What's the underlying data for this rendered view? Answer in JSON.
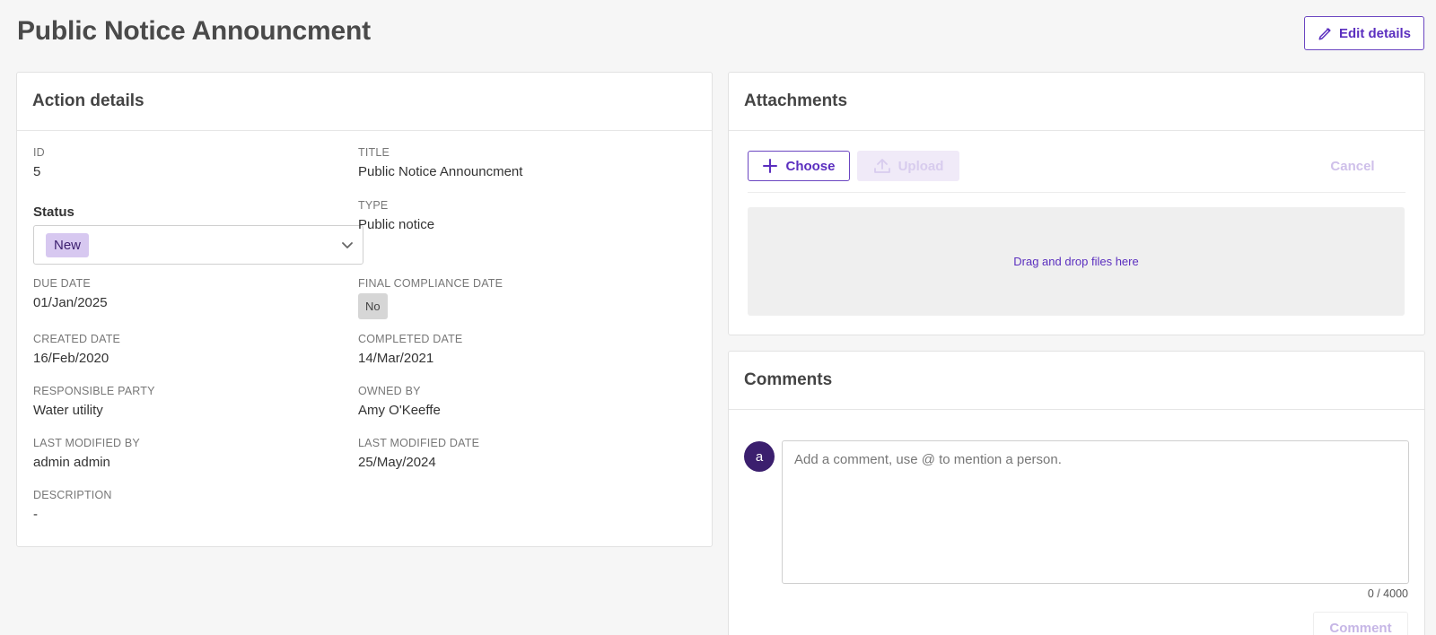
{
  "page": {
    "title": "Public Notice Announcment",
    "edit_label": "Edit details"
  },
  "details": {
    "header": "Action details",
    "id": {
      "label": "ID",
      "value": "5"
    },
    "title": {
      "label": "TITLE",
      "value": "Public Notice Announcment"
    },
    "status": {
      "label": "Status",
      "value": "New"
    },
    "type": {
      "label": "TYPE",
      "value": "Public notice"
    },
    "due_date": {
      "label": "DUE DATE",
      "value": "01/Jan/2025"
    },
    "final_compliance": {
      "label": "FINAL COMPLIANCE DATE",
      "value": "No"
    },
    "created_date": {
      "label": "CREATED DATE",
      "value": "16/Feb/2020"
    },
    "completed_date": {
      "label": "COMPLETED DATE",
      "value": "14/Mar/2021"
    },
    "responsible_party": {
      "label": "RESPONSIBLE PARTY",
      "value": "Water utility"
    },
    "owned_by": {
      "label": "OWNED BY",
      "value": "Amy O'Keeffe"
    },
    "last_modified_by": {
      "label": "LAST MODIFIED BY",
      "value": "admin admin"
    },
    "last_modified_date": {
      "label": "LAST MODIFIED DATE",
      "value": "25/May/2024"
    },
    "description": {
      "label": "DESCRIPTION",
      "value": "-"
    }
  },
  "attachments": {
    "header": "Attachments",
    "choose_label": "Choose",
    "upload_label": "Upload",
    "cancel_label": "Cancel",
    "dropzone_text": "Drag and drop files here"
  },
  "comments": {
    "header": "Comments",
    "avatar_initial": "a",
    "placeholder": "Add a comment, use @ to mention a person.",
    "counter": "0 / 4000",
    "submit_label": "Comment"
  },
  "icons": {
    "edit": "pencil-icon",
    "choose": "plus-icon",
    "upload": "upload-icon",
    "status_dropdown": "chevron-down-icon"
  },
  "colors": {
    "accent": "#5b2fbf",
    "status_chip_bg": "#d7c8f0",
    "avatar_bg": "#3b1f6e",
    "page_bg": "#f6f6f6"
  }
}
